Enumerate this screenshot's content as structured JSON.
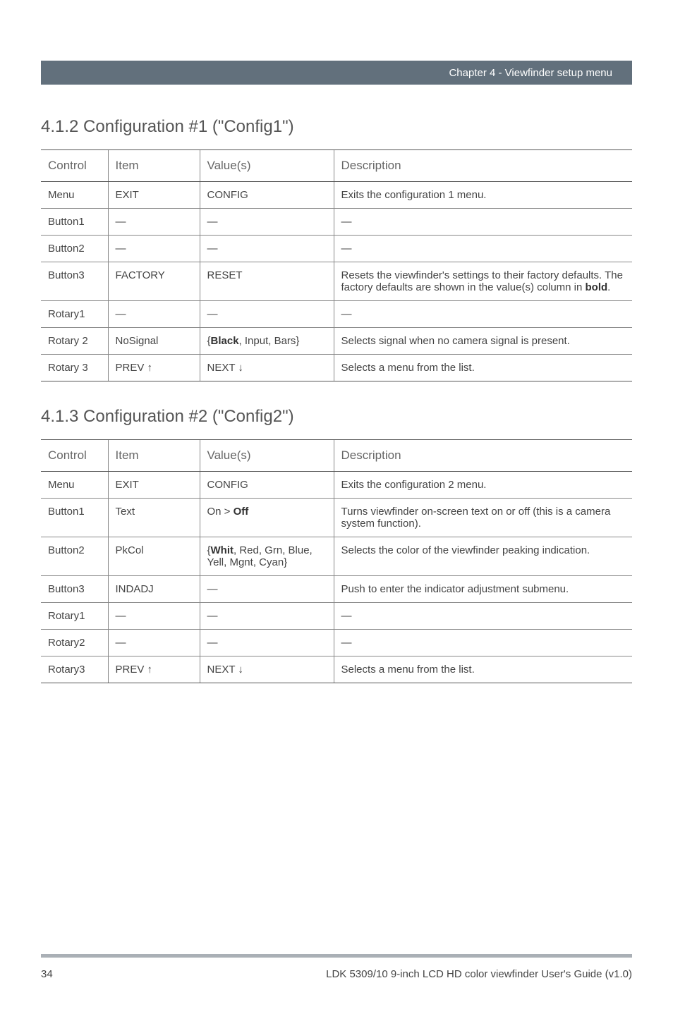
{
  "header": {
    "chapter": "Chapter 4 - Viewfinder setup menu"
  },
  "section1": {
    "title": "4.1.2  Configuration #1 (\"Config1\")",
    "columns": {
      "control": "Control",
      "item": "Item",
      "value": "Value(s)",
      "desc": "Description"
    },
    "rows": [
      {
        "control": "Menu",
        "item": "EXIT",
        "value": "CONFIG",
        "desc": "Exits the configuration 1 menu."
      },
      {
        "control": "Button1",
        "item": "—",
        "value": "—",
        "desc": "—"
      },
      {
        "control": "Button2",
        "item": "—",
        "value": "—",
        "desc": "—"
      },
      {
        "control": "Button3",
        "item": "FACTORY",
        "value": "RESET",
        "desc_pre": "Resets the viewfinder's settings to their factory defaults. The factory defaults are shown in the value(s) column in ",
        "desc_bold": "bold",
        "desc_post": "."
      },
      {
        "control": "Rotary1",
        "item": "—",
        "value": "—",
        "desc": "—"
      },
      {
        "control": "Rotary 2",
        "item": "NoSignal",
        "value_pre": "{",
        "value_bold": "Black",
        "value_post": ", Input, Bars}",
        "desc": "Selects signal when no camera signal is present."
      },
      {
        "control": "Rotary 3",
        "item": "PREV ↑",
        "value": "NEXT ↓",
        "desc": "Selects a menu from the list."
      }
    ]
  },
  "section2": {
    "title": "4.1.3  Configuration #2 (\"Config2\")",
    "columns": {
      "control": "Control",
      "item": "Item",
      "value": "Value(s)",
      "desc": "Description"
    },
    "rows": [
      {
        "control": "Menu",
        "item": "EXIT",
        "value": "CONFIG",
        "desc": "Exits the configuration 2 menu."
      },
      {
        "control": "Button1",
        "item": "Text",
        "value_pre": "On > ",
        "value_bold": "Off",
        "value_post": "",
        "desc": "Turns viewfinder on-screen text on or off (this is a camera system function)."
      },
      {
        "control": "Button2",
        "item": "PkCol",
        "value_pre": "{",
        "value_bold": "Whit",
        "value_post": ", Red, Grn, Blue, Yell, Mgnt, Cyan}",
        "desc": "Selects the color of the viewfinder peaking indication."
      },
      {
        "control": "Button3",
        "item": "INDADJ",
        "value": "—",
        "desc": "Push to enter the indicator adjustment submenu."
      },
      {
        "control": "Rotary1",
        "item": "—",
        "value": "—",
        "desc": "—"
      },
      {
        "control": "Rotary2",
        "item": "—",
        "value": "—",
        "desc": "—"
      },
      {
        "control": "Rotary3",
        "item": "PREV ↑",
        "value": "NEXT ↓",
        "desc": "Selects a menu from the list."
      }
    ]
  },
  "footer": {
    "page": "34",
    "doc": "LDK 5309/10 9-inch LCD HD color viewfinder User's Guide (v1.0)"
  }
}
